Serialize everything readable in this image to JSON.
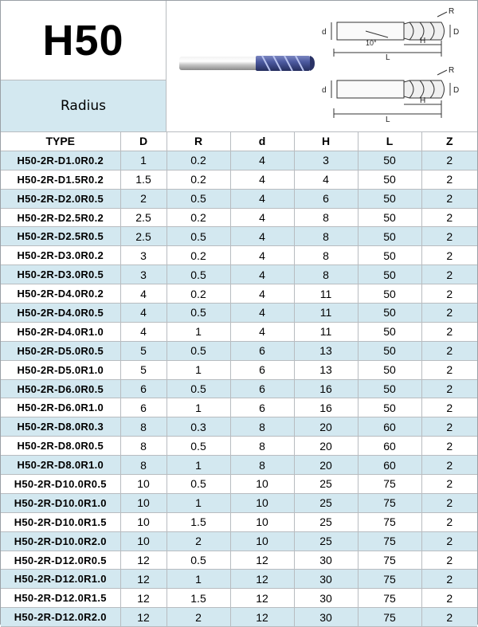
{
  "header": {
    "title": "H50",
    "subtitle": "Radius"
  },
  "drawing_labels": {
    "diameter": "D",
    "shank": "d",
    "radius": "R",
    "flute_length": "H",
    "overall_length": "L",
    "angle": "10°"
  },
  "colors": {
    "band": "#d3e8f0",
    "grid": "#b8bcc0",
    "coating": "#3c4a8a"
  },
  "table": {
    "columns": [
      "TYPE",
      "D",
      "R",
      "d",
      "H",
      "L",
      "Z"
    ],
    "rows": [
      [
        "H50-2R-D1.0R0.2",
        "1",
        "0.2",
        "4",
        "3",
        "50",
        "2"
      ],
      [
        "H50-2R-D1.5R0.2",
        "1.5",
        "0.2",
        "4",
        "4",
        "50",
        "2"
      ],
      [
        "H50-2R-D2.0R0.5",
        "2",
        "0.5",
        "4",
        "6",
        "50",
        "2"
      ],
      [
        "H50-2R-D2.5R0.2",
        "2.5",
        "0.2",
        "4",
        "8",
        "50",
        "2"
      ],
      [
        "H50-2R-D2.5R0.5",
        "2.5",
        "0.5",
        "4",
        "8",
        "50",
        "2"
      ],
      [
        "H50-2R-D3.0R0.2",
        "3",
        "0.2",
        "4",
        "8",
        "50",
        "2"
      ],
      [
        "H50-2R-D3.0R0.5",
        "3",
        "0.5",
        "4",
        "8",
        "50",
        "2"
      ],
      [
        "H50-2R-D4.0R0.2",
        "4",
        "0.2",
        "4",
        "11",
        "50",
        "2"
      ],
      [
        "H50-2R-D4.0R0.5",
        "4",
        "0.5",
        "4",
        "11",
        "50",
        "2"
      ],
      [
        "H50-2R-D4.0R1.0",
        "4",
        "1",
        "4",
        "11",
        "50",
        "2"
      ],
      [
        "H50-2R-D5.0R0.5",
        "5",
        "0.5",
        "6",
        "13",
        "50",
        "2"
      ],
      [
        "H50-2R-D5.0R1.0",
        "5",
        "1",
        "6",
        "13",
        "50",
        "2"
      ],
      [
        "H50-2R-D6.0R0.5",
        "6",
        "0.5",
        "6",
        "16",
        "50",
        "2"
      ],
      [
        "H50-2R-D6.0R1.0",
        "6",
        "1",
        "6",
        "16",
        "50",
        "2"
      ],
      [
        "H50-2R-D8.0R0.3",
        "8",
        "0.3",
        "8",
        "20",
        "60",
        "2"
      ],
      [
        "H50-2R-D8.0R0.5",
        "8",
        "0.5",
        "8",
        "20",
        "60",
        "2"
      ],
      [
        "H50-2R-D8.0R1.0",
        "8",
        "1",
        "8",
        "20",
        "60",
        "2"
      ],
      [
        "H50-2R-D10.0R0.5",
        "10",
        "0.5",
        "10",
        "25",
        "75",
        "2"
      ],
      [
        "H50-2R-D10.0R1.0",
        "10",
        "1",
        "10",
        "25",
        "75",
        "2"
      ],
      [
        "H50-2R-D10.0R1.5",
        "10",
        "1.5",
        "10",
        "25",
        "75",
        "2"
      ],
      [
        "H50-2R-D10.0R2.0",
        "10",
        "2",
        "10",
        "25",
        "75",
        "2"
      ],
      [
        "H50-2R-D12.0R0.5",
        "12",
        "0.5",
        "12",
        "30",
        "75",
        "2"
      ],
      [
        "H50-2R-D12.0R1.0",
        "12",
        "1",
        "12",
        "30",
        "75",
        "2"
      ],
      [
        "H50-2R-D12.0R1.5",
        "12",
        "1.5",
        "12",
        "30",
        "75",
        "2"
      ],
      [
        "H50-2R-D12.0R2.0",
        "12",
        "2",
        "12",
        "30",
        "75",
        "2"
      ]
    ]
  }
}
